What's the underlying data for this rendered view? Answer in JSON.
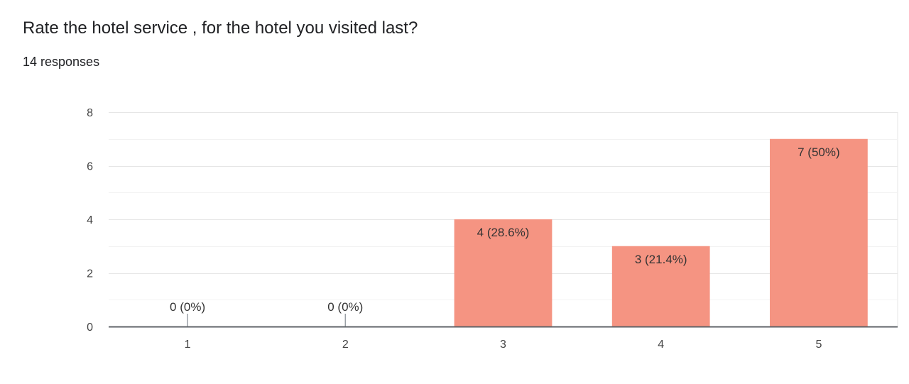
{
  "question": {
    "title": "Rate the hotel service , for the hotel you visited last?",
    "responses": "14 responses"
  },
  "colors": {
    "bar": "#f59482",
    "gridline": "#e6e6e6",
    "axis": "#5f6368",
    "tick_text": "#444444",
    "label_text": "#333333"
  },
  "chart_data": {
    "type": "bar",
    "categories": [
      "1",
      "2",
      "3",
      "4",
      "5"
    ],
    "values": [
      0,
      0,
      4,
      3,
      7
    ],
    "data_labels": [
      "0 (0%)",
      "0 (0%)",
      "4 (28.6%)",
      "3 (21.4%)",
      "7 (50%)"
    ],
    "yticks": [
      "0",
      "2",
      "4",
      "6",
      "8"
    ],
    "ylim": [
      0,
      8
    ],
    "grid": true,
    "legend": "none",
    "title": "",
    "xlabel": "",
    "ylabel": ""
  }
}
